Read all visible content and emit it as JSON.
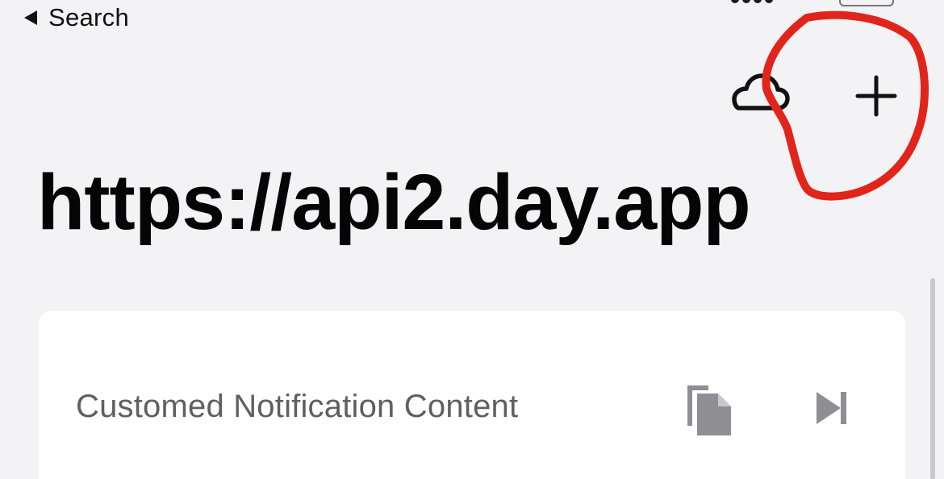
{
  "status_bar": {
    "back_label": "Search",
    "back_icon": "back-triangle-icon"
  },
  "toolbar": {
    "cloud_icon": "cloud-icon",
    "add_icon": "plus-icon"
  },
  "page": {
    "title": "https://api2.day.app"
  },
  "card": {
    "row_label": "Customed Notification Content",
    "copy_icon": "copy-document-icon",
    "send_icon": "play-skip-icon"
  },
  "colors": {
    "background": "#f3f2f4",
    "card": "#ffffff",
    "icon_gray": "#8e8e93",
    "annotation_red": "#e1251b"
  }
}
